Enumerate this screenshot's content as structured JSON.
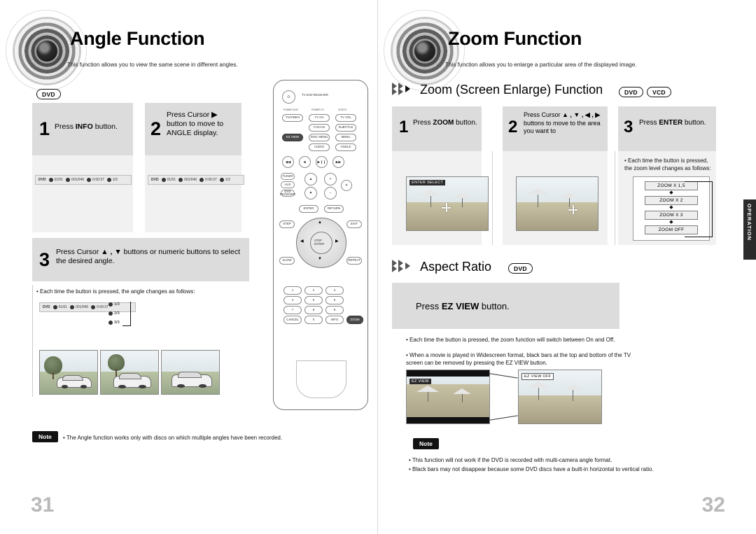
{
  "left": {
    "title": "Angle Function",
    "subtitle": "This function allows you to view the same scene in different angles.",
    "disc_badges": [
      "DVD"
    ],
    "steps": [
      {
        "num": "1",
        "text_parts": [
          "Press ",
          "INFO",
          " button."
        ]
      },
      {
        "num": "2",
        "text_parts": [
          "Press Cursor ",
          "▶",
          " button to move to ANGLE display."
        ]
      },
      {
        "num": "3",
        "text_parts": [
          "Press Cursor ",
          "▲ , ▼",
          " buttons or numeric buttons to select the desired angle."
        ]
      }
    ],
    "osd_1": [
      "DVD",
      "01/01",
      "001/040",
      "0:00:37",
      "1/3"
    ],
    "osd_2": [
      "DVD",
      "01/01",
      "001/040",
      "0:00:37",
      "1/3"
    ],
    "note_bullet": "Each time the button is pressed, the angle changes as follows:",
    "angle_list": [
      "1/3",
      "2/3",
      "3/3"
    ],
    "angle_osd": [
      "DVD",
      "01/01",
      "001/040",
      "0:00:37",
      "1/3"
    ],
    "note_label": "Note",
    "note_text": "The Angle function works only with discs on which multiple angles have been recorded.",
    "page_number": "31"
  },
  "right": {
    "title": "Zoom Function",
    "subtitle": "This function allows you to enlarge a particular area of the displayed image.",
    "section1": {
      "heading": "Zoom (Screen Enlarge) Function",
      "badges": [
        "DVD",
        "VCD"
      ],
      "steps": [
        {
          "num": "1",
          "text_parts": [
            "Press ",
            "ZOOM",
            " button."
          ]
        },
        {
          "num": "2",
          "text_parts": [
            "Press Cursor ",
            "▲ , ▼ , ◀ , ▶",
            " buttons to move to the area you want to"
          ]
        },
        {
          "num": "3",
          "text_parts": [
            "Press ",
            "ENTER",
            " button."
          ]
        }
      ],
      "screen_tag": "ENTER SELECT",
      "bullet": "Each time the button is pressed, the zoom level changes as follows:",
      "ladder": [
        "ZOOM X 1,5",
        "ZOOM X 2",
        "ZOOM X 3",
        "ZOOM OFF"
      ]
    },
    "section2": {
      "heading": "Aspect Ratio",
      "badges": [
        "DVD"
      ],
      "instruction_parts": [
        "Press ",
        "EZ VIEW",
        " button."
      ],
      "bullets": [
        "Each time the button is pressed, the zoom function will switch between On and Off.",
        "When a movie is played in Widescreen format, black bars at the top and bottom of the TV screen can be removed by pressing the EZ VIEW button."
      ],
      "screen_tag_left": "EZ VIEW",
      "screen_tag_right": "EZ VIEW OFF",
      "note_label": "Note",
      "notes": [
        "This function will not work if the DVD is recorded with multi-camera angle format.",
        "Black bars may not disappear because some DVD discs have a built-in horizontal to vertical ratio."
      ]
    },
    "side_tab": "OPERATION",
    "page_number": "32"
  },
  "remote": {
    "top_label": "TV DVD RECEIVER",
    "row_labels": [
      "POWER DVD",
      "POWER TV",
      "VCR/TV",
      "SLEEP"
    ],
    "buttons": [
      "TV/VIDEO",
      "TV CH",
      "TV VOL",
      "EZ VIEW",
      "P.SCAN",
      "SUBTITLE",
      "DISC MENU",
      "MENU",
      "AUDIO",
      "ANGLE",
      "INFO",
      "ZOOM",
      "TUNER",
      "AUX",
      "DVD RECEIVER",
      "ENTER",
      "RETURN",
      "EXIT",
      "STEP",
      "SLOW",
      "REPEAT",
      "1",
      "2",
      "3",
      "4",
      "5",
      "6",
      "7",
      "8",
      "9",
      "0",
      "CANCEL",
      "ZOOM"
    ]
  }
}
